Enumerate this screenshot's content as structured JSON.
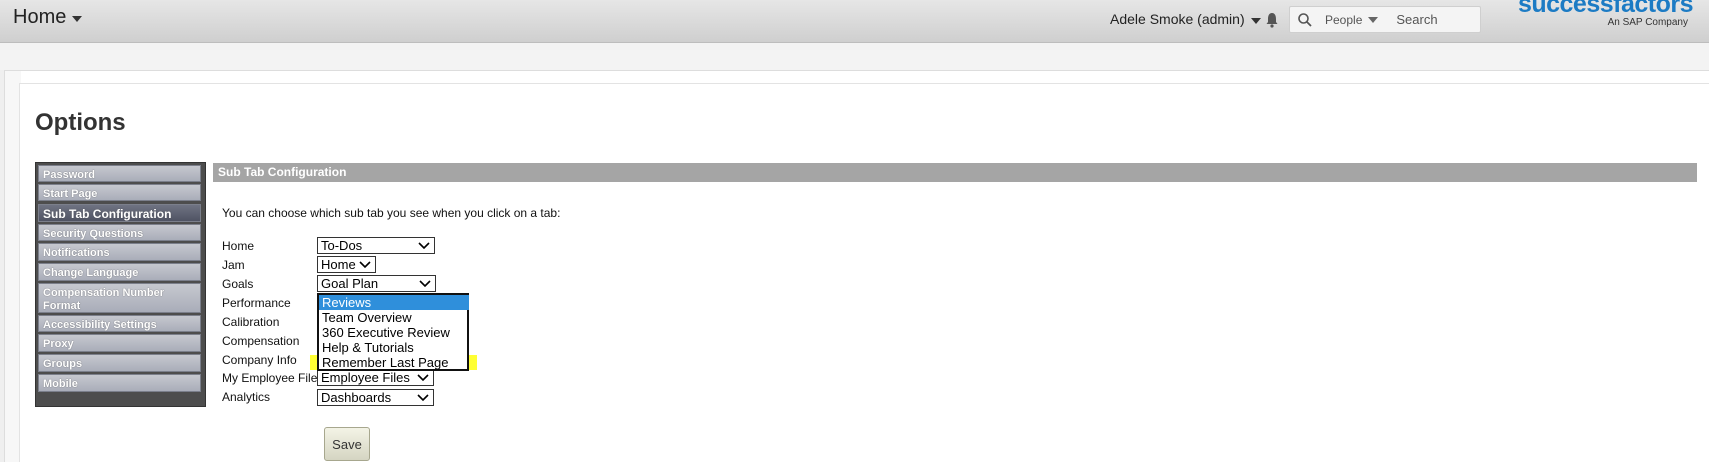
{
  "header": {
    "home_label": "Home",
    "user_label": "Adele Smoke (admin)",
    "search_scope": "People",
    "search_placeholder": "Search",
    "logo_text": "successfactors",
    "logo_subtext": "An SAP Company"
  },
  "page_title": "Options",
  "nav": {
    "items": [
      {
        "label": "Password"
      },
      {
        "label": "Start Page"
      },
      {
        "label": "Sub Tab Configuration",
        "active": true
      },
      {
        "label": "Security Questions"
      },
      {
        "label": "Notifications"
      },
      {
        "label": "Change Language"
      },
      {
        "label": "Compensation Number Format"
      },
      {
        "label": "Accessibility Settings"
      },
      {
        "label": "Proxy"
      },
      {
        "label": "Groups"
      },
      {
        "label": "Mobile"
      }
    ]
  },
  "panel": {
    "title": "Sub Tab Configuration",
    "intro": "You can choose which sub tab you see when you click on a tab:",
    "rows": [
      {
        "label": "Home",
        "value": "To-Dos"
      },
      {
        "label": "Jam",
        "value": "Home"
      },
      {
        "label": "Goals",
        "value": "Goal Plan"
      },
      {
        "label": "Performance",
        "value": "Reviews"
      },
      {
        "label": "Calibration",
        "value": ""
      },
      {
        "label": "Compensation",
        "value": ""
      },
      {
        "label": "Company Info",
        "value": ""
      },
      {
        "label": "My Employee File",
        "value": "Employee Files"
      },
      {
        "label": "Analytics",
        "value": "Dashboards"
      }
    ],
    "open_dropdown": {
      "options": [
        "Reviews",
        "Team Overview",
        "360 Executive Review",
        "Help & Tutorials",
        "Remember Last Page"
      ],
      "selected": "Reviews",
      "highlighted": "Remember Last Page"
    },
    "save_label": "Save"
  },
  "colors": {
    "logo_blue": "#1c7bc4",
    "dropdown_selected": "#2f8fdb",
    "highlight_yellow": "#ffff33",
    "panel_header": "#a5a5a5"
  }
}
